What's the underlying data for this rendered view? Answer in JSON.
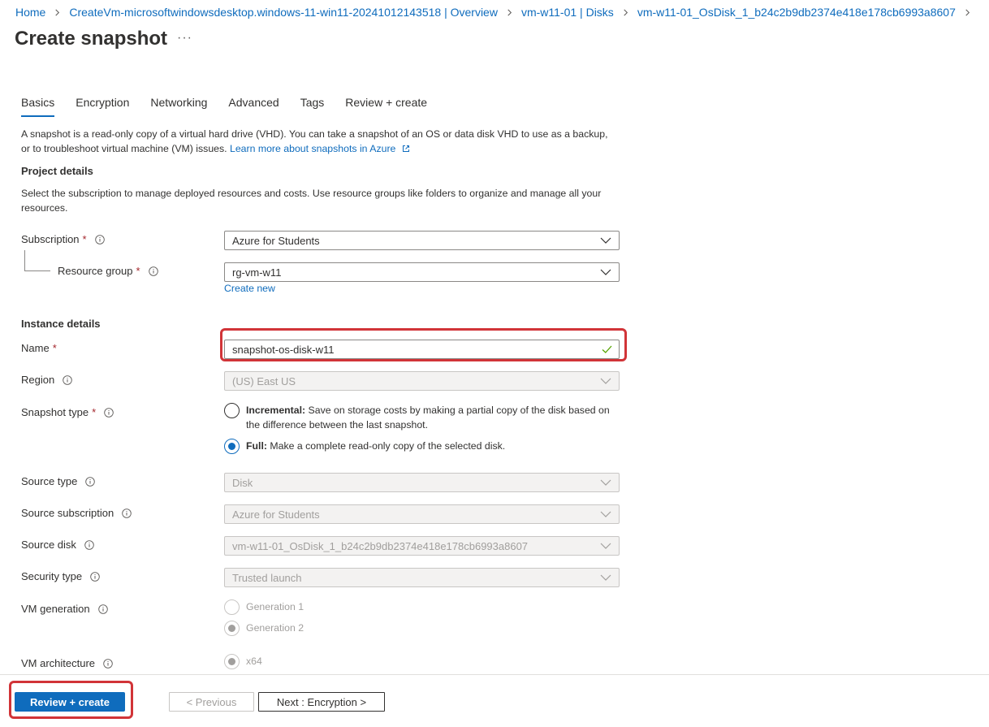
{
  "breadcrumb": [
    "Home",
    "CreateVm-microsoftwindowsdesktop.windows-11-win11-20241012143518 | Overview",
    "vm-w11-01 | Disks",
    "vm-w11-01_OsDisk_1_b24c2b9db2374e418e178cb6993a8607"
  ],
  "page": {
    "title": "Create snapshot",
    "more": "···"
  },
  "tabs": [
    "Basics",
    "Encryption",
    "Networking",
    "Advanced",
    "Tags",
    "Review + create"
  ],
  "intro": {
    "text": "A snapshot is a read-only copy of a virtual hard drive (VHD). You can take a snapshot of an OS or data disk VHD to use as a backup, or to troubleshoot virtual machine (VM) issues. ",
    "link": "Learn more about snapshots in Azure"
  },
  "project": {
    "heading": "Project details",
    "description": "Select the subscription to manage deployed resources and costs. Use resource groups like folders to organize and manage all your resources.",
    "subscription_label": "Subscription",
    "subscription_value": "Azure for Students",
    "resource_group_label": "Resource group",
    "resource_group_value": "rg-vm-w11",
    "create_new": "Create new"
  },
  "instance": {
    "heading": "Instance details",
    "name_label": "Name",
    "name_value": "snapshot-os-disk-w11",
    "region_label": "Region",
    "region_value": "(US) East US",
    "snapshot_type_label": "Snapshot type",
    "incremental_title": "Incremental:",
    "incremental_desc": " Save on storage costs by making a partial copy of the disk based on the difference between the last snapshot.",
    "full_title": "Full:",
    "full_desc": " Make a complete read-only copy of the selected disk.",
    "source_type_label": "Source type",
    "source_type_value": "Disk",
    "source_subscription_label": "Source subscription",
    "source_subscription_value": "Azure for Students",
    "source_disk_label": "Source disk",
    "source_disk_value": "vm-w11-01_OsDisk_1_b24c2b9db2374e418e178cb6993a8607",
    "security_type_label": "Security type",
    "security_type_value": "Trusted launch",
    "vm_generation_label": "VM generation",
    "gen1": "Generation 1",
    "gen2": "Generation 2",
    "vm_architecture_label": "VM architecture",
    "arch": "x64"
  },
  "footer": {
    "review_create": "Review + create",
    "previous": "< Previous",
    "next": "Next : Encryption >"
  },
  "colors": {
    "accent": "#0f6cbd",
    "highlight": "#d13438",
    "required": "#a4262c",
    "valid": "#57a300"
  }
}
